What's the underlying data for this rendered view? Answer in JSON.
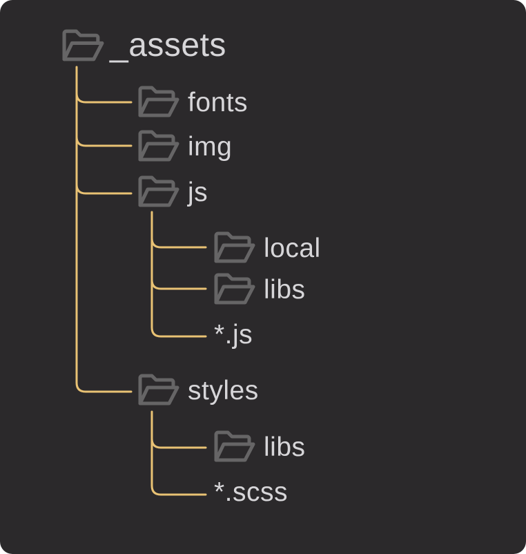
{
  "colors": {
    "background": "#2b292b",
    "connector": "#e9c274",
    "folder_icon": "#666566",
    "text": "#d7d6d9"
  },
  "tree": {
    "root": {
      "label": "_assets",
      "icon": "folder-open-icon"
    },
    "fonts": {
      "label": "fonts",
      "icon": "folder-open-icon"
    },
    "img": {
      "label": "img",
      "icon": "folder-open-icon"
    },
    "js": {
      "label": "js",
      "icon": "folder-open-icon",
      "local": {
        "label": "local",
        "icon": "folder-open-icon"
      },
      "libs": {
        "label": "libs",
        "icon": "folder-open-icon"
      },
      "files": {
        "label": "*.js"
      }
    },
    "styles": {
      "label": "styles",
      "icon": "folder-open-icon",
      "libs": {
        "label": "libs",
        "icon": "folder-open-icon"
      },
      "files": {
        "label": "*.scss"
      }
    }
  }
}
